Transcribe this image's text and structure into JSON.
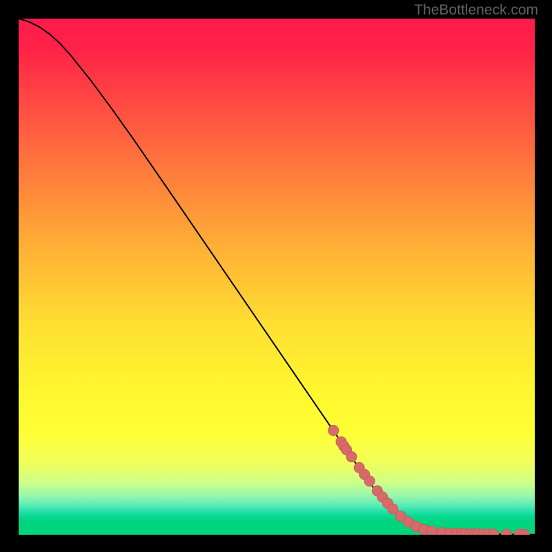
{
  "watermark": "TheBottleneck.com",
  "colors": {
    "bg": "#000000",
    "line": "#000000",
    "marker_fill": "#d86a6a",
    "marker_stroke": "#c95b5b",
    "gradient_stops": [
      {
        "offset": 0.0,
        "color": "#ff1a4b"
      },
      {
        "offset": 0.06,
        "color": "#ff2348"
      },
      {
        "offset": 0.25,
        "color": "#ff6a3e"
      },
      {
        "offset": 0.45,
        "color": "#ffb236"
      },
      {
        "offset": 0.6,
        "color": "#ffe132"
      },
      {
        "offset": 0.72,
        "color": "#fff72f"
      },
      {
        "offset": 0.8,
        "color": "#ffff33"
      },
      {
        "offset": 0.86,
        "color": "#f1ff5a"
      },
      {
        "offset": 0.9,
        "color": "#ccff8a"
      },
      {
        "offset": 0.925,
        "color": "#96f7ae"
      },
      {
        "offset": 0.945,
        "color": "#54e9b5"
      },
      {
        "offset": 0.955,
        "color": "#22e0a8"
      },
      {
        "offset": 0.965,
        "color": "#08d88f"
      },
      {
        "offset": 0.975,
        "color": "#00d57e"
      },
      {
        "offset": 1.0,
        "color": "#00d57e"
      }
    ]
  },
  "chart_data": {
    "type": "line",
    "title": "",
    "xlabel": "",
    "ylabel": "",
    "xlim": [
      0,
      100
    ],
    "ylim": [
      0,
      100
    ],
    "series": [
      {
        "name": "curve",
        "x": [
          0,
          2,
          4,
          6,
          8,
          10,
          14,
          18,
          22,
          26,
          30,
          35,
          40,
          45,
          50,
          55,
          60,
          65,
          70,
          74,
          77,
          80,
          82,
          84,
          85,
          86,
          87,
          88,
          89,
          90,
          92,
          94,
          96,
          98,
          100
        ],
        "y": [
          100,
          99.4,
          98.4,
          97.0,
          95.2,
          93.0,
          88.0,
          82.6,
          77.0,
          71.2,
          65.4,
          58.1,
          50.8,
          43.5,
          36.2,
          28.9,
          21.6,
          14.3,
          7.4,
          3.3,
          1.5,
          0.7,
          0.4,
          0.25,
          0.22,
          0.2,
          0.18,
          0.16,
          0.14,
          0.13,
          0.1,
          0.08,
          0.06,
          0.04,
          0.03
        ]
      }
    ],
    "markers": {
      "name": "highlighted-points",
      "x": [
        61,
        62.5,
        63,
        63.5,
        64.5,
        66,
        67,
        68,
        69.5,
        70.5,
        71.5,
        72.5,
        74,
        75.5,
        77,
        78.5,
        80,
        82,
        83.5,
        84.8,
        85.8,
        86.5,
        87.5,
        88.3,
        89,
        90,
        91,
        92,
        94.5,
        97,
        98
      ],
      "y": [
        20.2,
        18.0,
        17.2,
        16.5,
        15.1,
        13.0,
        11.7,
        10.4,
        8.5,
        7.3,
        6.1,
        5.0,
        3.6,
        2.5,
        1.6,
        1.0,
        0.7,
        0.4,
        0.3,
        0.25,
        0.22,
        0.2,
        0.18,
        0.16,
        0.15,
        0.14,
        0.12,
        0.11,
        0.09,
        0.06,
        0.05
      ]
    }
  }
}
